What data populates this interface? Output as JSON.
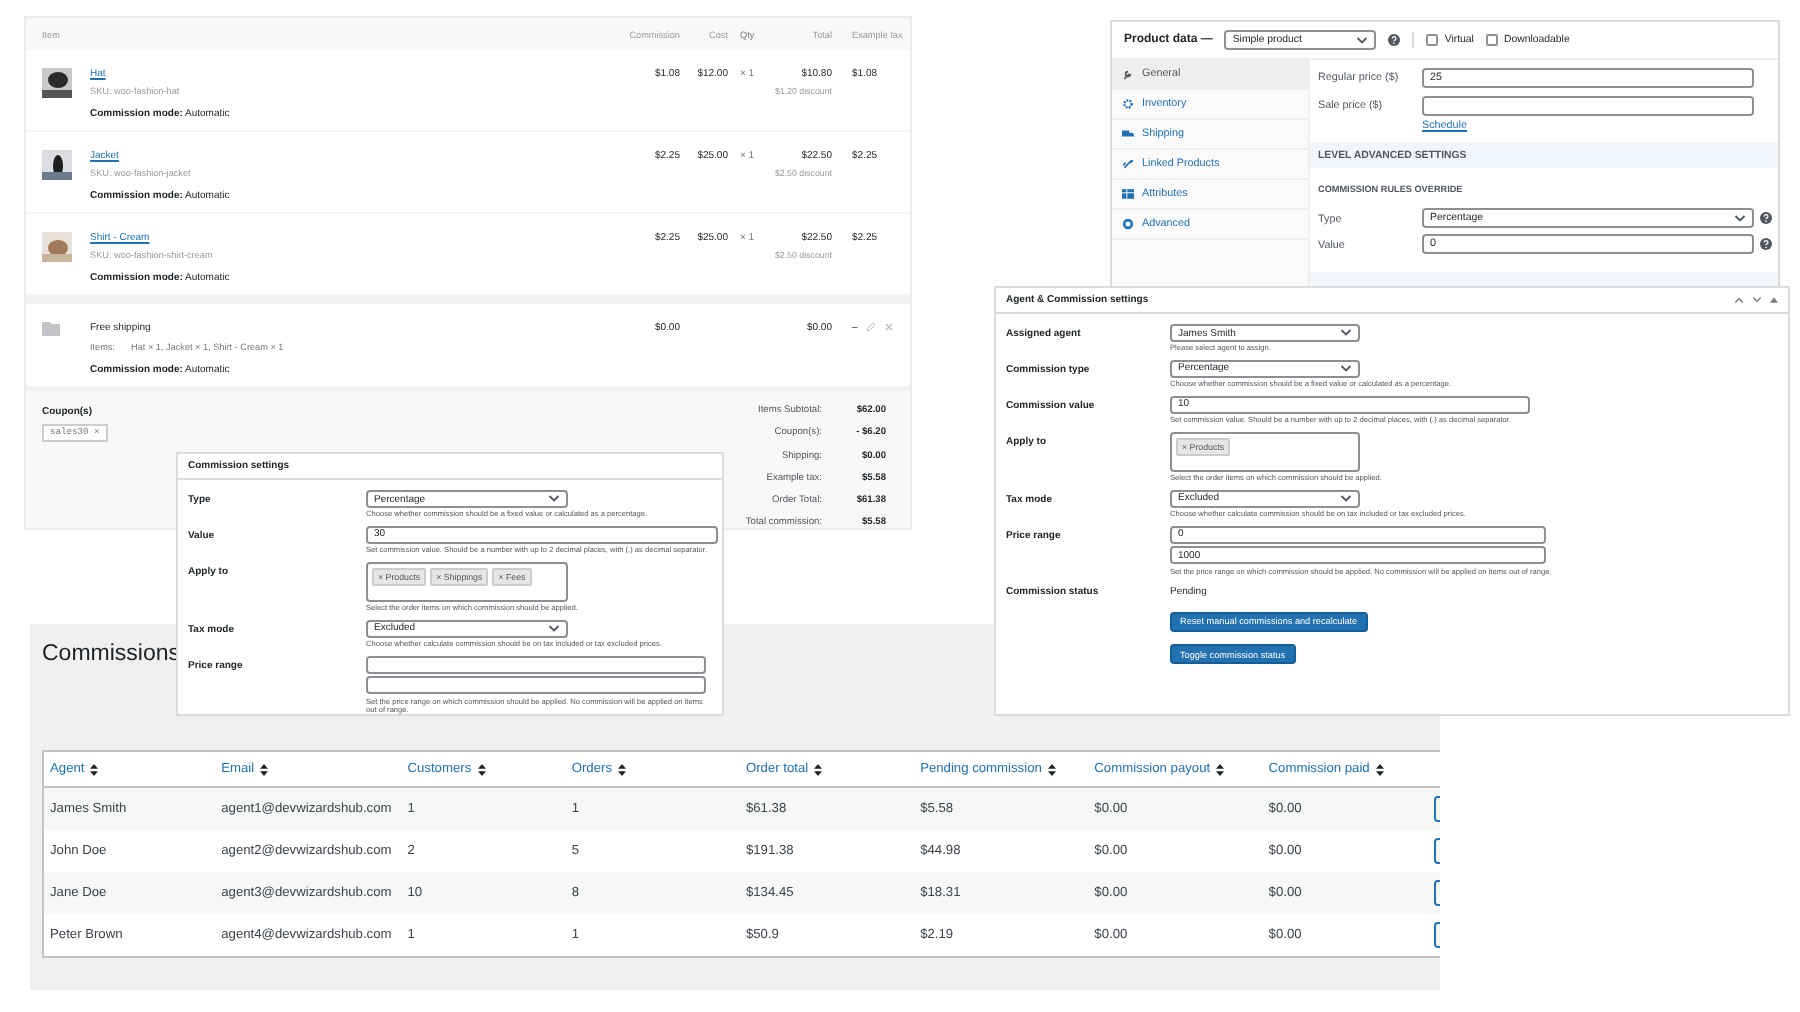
{
  "order_items": {
    "columns": [
      "Item",
      "Commission",
      "Cost",
      "Qty",
      "Total",
      "Example tax"
    ],
    "items": [
      {
        "name": "Hat",
        "sku": "SKU: woo-fashion-hat",
        "commission": "$1.08",
        "cost": "$12.00",
        "qty": "× 1",
        "total": "$10.80",
        "discount": "$1.20 discount",
        "tax": "$1.08",
        "mode": "**Commission mode:** Automatic"
      },
      {
        "name": "Jacket",
        "sku": "SKU: woo-fashion-jacket",
        "commission": "$2.25",
        "cost": "$25.00",
        "qty": "× 1",
        "total": "$22.50",
        "discount": "$2.50 discount",
        "tax": "$2.25",
        "mode": "**Commission mode:** Automatic"
      },
      {
        "name": "Shirt - Cream",
        "sku": "SKU: woo-fashion-shirt-cream",
        "commission": "$2.25",
        "cost": "$25.00",
        "qty": "× 1",
        "total": "$22.50",
        "discount": "$2.50 discount",
        "tax": "$2.25",
        "mode": "**Commission mode:** Automatic"
      }
    ],
    "shipping": {
      "name": "Free shipping",
      "items_label": "Items:",
      "items": "Hat × 1, Jacket × 1, Shirt - Cream × 1",
      "commission": "$0.00",
      "total": "$0.00",
      "tax": "–",
      "mode": "**Commission mode:** Automatic"
    },
    "coupons": {
      "label": "Coupon(s)",
      "codes": [
        "sales30 ×"
      ]
    },
    "totals": [
      {
        "label": "Items Subtotal:",
        "value": "$62.00"
      },
      {
        "label": "Coupon(s):",
        "value": "- $6.20"
      },
      {
        "label": "Shipping:",
        "value": "$0.00"
      },
      {
        "label": "Example tax:",
        "value": "$5.58"
      },
      {
        "label": "Order Total:",
        "value": "$61.38"
      },
      {
        "label": "Total commission:",
        "value": "$5.58"
      }
    ]
  },
  "product_data": {
    "label": "Product data —",
    "type": "Simple product",
    "checkboxes": [
      {
        "label": "Virtual",
        "checked": false
      },
      {
        "label": "Downloadable",
        "checked": false
      }
    ],
    "tabs": [
      {
        "label": "General",
        "selected": true
      },
      {
        "label": "Inventory",
        "selected": false
      },
      {
        "label": "Shipping",
        "selected": false
      },
      {
        "label": "Linked Products",
        "selected": false
      },
      {
        "label": "Attributes",
        "selected": false
      },
      {
        "label": "Advanced",
        "selected": false
      }
    ],
    "prices": [
      {
        "label": "Regular price ($)",
        "value": "25"
      },
      {
        "label": "Sale price ($)",
        "link": "Schedule"
      }
    ],
    "section": "LEVEL ADVANCED SETTINGS",
    "subsection": "COMMISSION RULES OVERRIDE",
    "overrides": [
      {
        "kind": "select",
        "label": "Type",
        "value": "Percentage"
      },
      {
        "kind": "input",
        "label": "Value",
        "value": "0"
      }
    ]
  },
  "commissions_page": {
    "title": "Commissions",
    "columns": [
      "Agent",
      "Email",
      "Customers",
      "Orders",
      "Order total",
      "Pending commission",
      "Commission payout",
      "Commission paid"
    ],
    "rows": [
      [
        "James Smith",
        "agent1@devwizardshub.com",
        "1",
        "1",
        "$61.38",
        "$5.58",
        "$0.00",
        "$0.00"
      ],
      [
        "John Doe",
        "agent2@devwizardshub.com",
        "2",
        "5",
        "$191.38",
        "$44.98",
        "$0.00",
        "$0.00"
      ],
      [
        "Jane Doe",
        "agent3@devwizardshub.com",
        "10",
        "8",
        "$134.45",
        "$18.31",
        "$0.00",
        "$0.00"
      ],
      [
        "Peter Brown",
        "agent4@devwizardshub.com",
        "1",
        "1",
        "$50.9",
        "$2.19",
        "$0.00",
        "$0.00"
      ]
    ]
  },
  "commission_settings": {
    "title": "Commission settings",
    "fields": [
      {
        "kind": "select",
        "label": "Type",
        "value": "Percentage",
        "hint": "Choose whether commission should be a fixed value or calculated as a percentage."
      },
      {
        "kind": "input",
        "label": "Value",
        "value": "30",
        "hint": "Set commission value. Should be a number with up to 2 decimal places, with (.) as decimal separator."
      },
      {
        "kind": "multi",
        "label": "Apply to",
        "chips": [
          "× Products",
          "× Shippings",
          "× Fees"
        ],
        "hint": "Select the order items on which commission should be applied."
      },
      {
        "kind": "select",
        "label": "Tax mode",
        "value": "Excluded",
        "hint": "Choose whether calculate commission should be on tax included or tax excluded prices."
      },
      {
        "kind": "range",
        "label": "Price range",
        "hint": "Set the price range on which commission should be applied. No commission will be applied on items out of range."
      }
    ]
  },
  "agent_settings": {
    "title": "Agent & Commission settings",
    "fields": [
      {
        "kind": "select",
        "label": "Assigned agent",
        "value": "James Smith",
        "hint": "Please select agent to assign."
      },
      {
        "kind": "select",
        "label": "Commission type",
        "value": "Percentage",
        "hint": "Choose whether commission should be a fixed value or calculated as a percentage."
      },
      {
        "kind": "input",
        "label": "Commission value",
        "value": "10",
        "hint": "Set commission value. Should be a number with up to 2 decimal places, with (.) as decimal separator."
      },
      {
        "kind": "multi",
        "label": "Apply to",
        "chips": [
          "× Products"
        ],
        "hint": "Select the order items on which commission should be applied."
      },
      {
        "kind": "select",
        "label": "Tax mode",
        "value": "Excluded",
        "hint": "Choose whether calculate commission should be on tax included or tax excluded prices."
      },
      {
        "kind": "range",
        "label": "Price range",
        "min": "0",
        "max": "1000",
        "hint": "Set the price range on which commission should be applied. No commission will be applied on items out of range."
      },
      {
        "kind": "text",
        "label": "Commission status",
        "value": "Pending"
      },
      {
        "kind": "button",
        "label": "Reset manual commissions and recalculate"
      },
      {
        "kind": "button",
        "label": "Toggle commission status"
      }
    ]
  }
}
